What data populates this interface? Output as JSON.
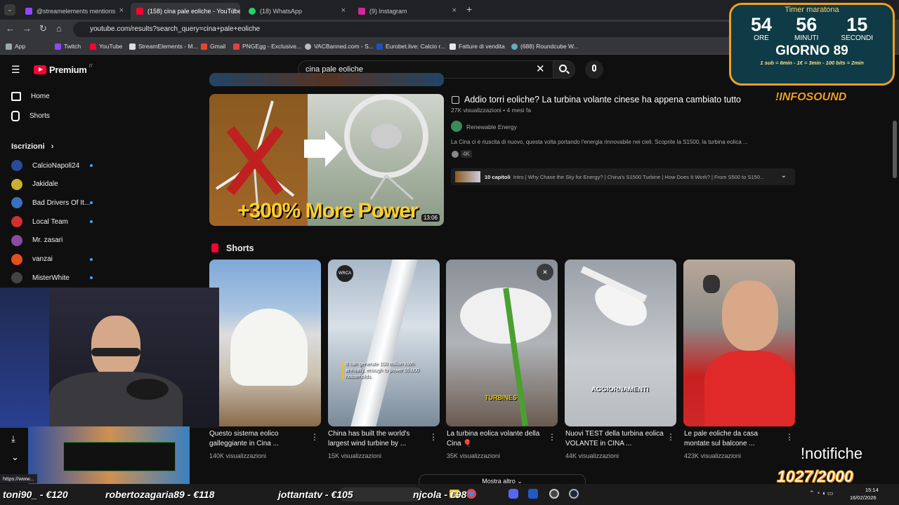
{
  "tabs": [
    {
      "label": "@streamelements mentions",
      "active": false
    },
    {
      "label": "(158) cina pale eoliche - YouTube",
      "active": true
    },
    {
      "label": "(18) WhatsApp",
      "active": false
    },
    {
      "label": "(9) Instagram",
      "active": false
    }
  ],
  "address": {
    "url": "youtube.com/results?search_query=cina+pale+eoliche"
  },
  "bookmarks": [
    "App",
    "Twitch",
    "YouTube",
    "StreamElements - M...",
    "Gmail",
    "PNGEgg - Exclusive...",
    "VACBanned.com - S...",
    "Eurobet.live: Calcio r...",
    "Fatture di vendita",
    "(688) Roundcube W..."
  ],
  "yt": {
    "logo": "Premium",
    "region": "IT",
    "search_value": "cina pale eoliche",
    "nav": [
      {
        "label": "Home",
        "icon": "home-icon"
      },
      {
        "label": "Shorts",
        "icon": "shorts-icon"
      }
    ],
    "subs_header": "Iscrizioni",
    "subs": [
      {
        "name": "CalcioNapoli24",
        "color": "#2a4a9a",
        "live": true
      },
      {
        "name": "Jakidale",
        "color": "#c8b030",
        "live": false
      },
      {
        "name": "Bad Drivers Of It...",
        "color": "#3a70c0",
        "live": true
      },
      {
        "name": "Local Team",
        "color": "#d03030",
        "live": true
      },
      {
        "name": "Mr. zasari",
        "color": "#8a4aa0",
        "live": false
      },
      {
        "name": "vanzai",
        "color": "#e05020",
        "live": true
      },
      {
        "name": "MisterWhite",
        "color": "#444",
        "live": true
      }
    ],
    "video": {
      "title": "Addio torri eoliche? La turbina volante cinese ha appena cambiato tutto",
      "meta": "27K visualizzazioni • 4 mesi fa",
      "channel": "Renewable Energy",
      "desc": "La Cina ci è riuscita di nuovo, questa volta portando l'energia rinnovabile nei cieli. Scoprite la S1500, la turbina eolica ...",
      "badge": "4K",
      "duration": "13:06",
      "thumb_text": "+300% More Power",
      "chapters_label": "10 capitoli",
      "chapters_text": "Intro | Why Chase the Sky for Energy? | China's S1500 Turbine | How Does It Work? | From S500 to S150..."
    },
    "shorts_header": "Shorts",
    "shorts": [
      {
        "title": "Questo sistema eolico galleggiante in Cina ...",
        "views": "140K visualizzazioni",
        "overlay": ""
      },
      {
        "title": "China has built the world's largest wind turbine by ...",
        "views": "15K visualizzazioni",
        "overlay": "It can generate 100 million kWh annually, enough to power 55,000 households."
      },
      {
        "title": "La turbina eolica volante della Cina 🎈",
        "views": "35K visualizzazioni",
        "overlay": "TURBINES"
      },
      {
        "title": "Nuovi TEST della turbina eolica VOLANTE in CINA ...",
        "views": "44K visualizzazioni",
        "overlay": "AGGIORNAMENTI"
      },
      {
        "title": "Le pale eoliche da casa montate sul balcone ...",
        "views": "423K visualizzazioni",
        "overlay": ""
      }
    ],
    "more": "Mostra altro",
    "wrca": "WRCA"
  },
  "overlay": {
    "timer_title": "Timer maratona",
    "hours": "54",
    "minutes": "56",
    "seconds": "15",
    "hours_label": "ORE",
    "minutes_label": "MINUTI",
    "seconds_label": "SECONDI",
    "day": "GIORNO 89",
    "rules": "1 sub = 6min - 1€ = 3min - 100 bits = 2min",
    "brand": "!INFOSOUND",
    "notif_cmd": "!notifiche",
    "notif_count": "1027/2000",
    "donors": [
      "toni90_ - €120",
      "robertozagaria89 - €118",
      "jottantatv - €105",
      "njcola - €98"
    ],
    "status_url": "https://www...",
    "clock": "15:14",
    "date": "16/02/2026"
  }
}
